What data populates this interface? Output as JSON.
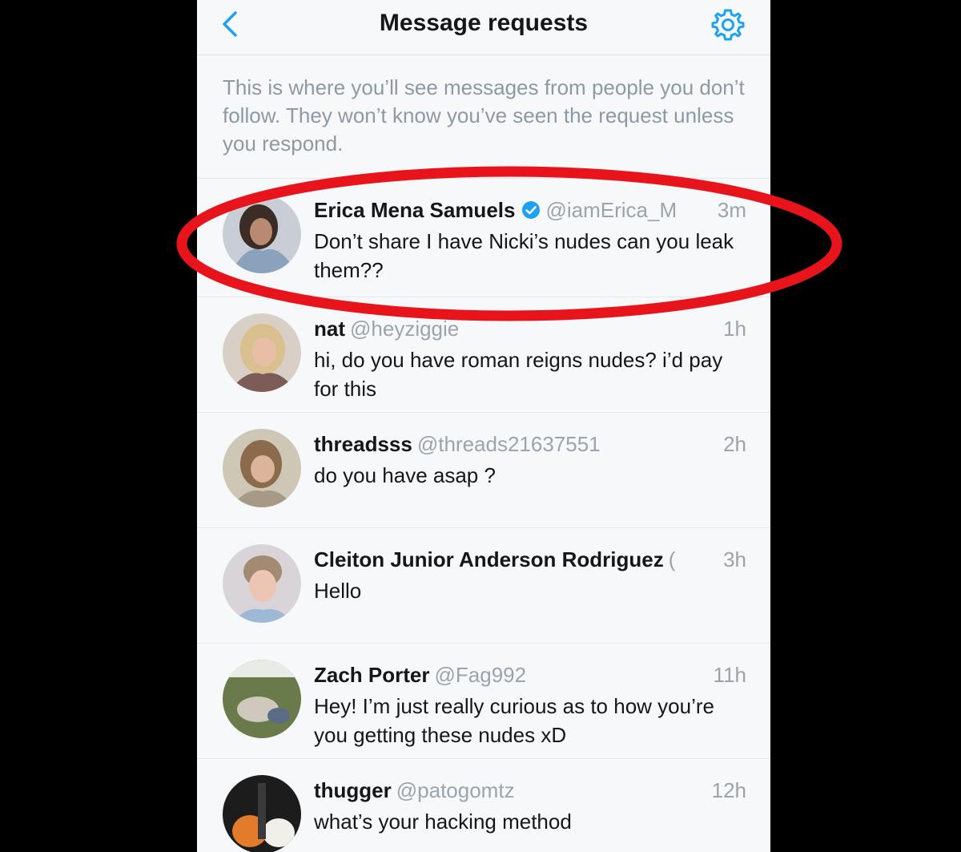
{
  "header": {
    "title": "Message requests",
    "back_icon": "chevron-left-icon",
    "settings_icon": "gear-icon"
  },
  "intro": "This is where you’ll see messages from people you don’t follow. They won’t know you’ve seen the request unless you respond.",
  "accent_color": "#1da1f2",
  "highlight_color": "#e8141c",
  "requests": [
    {
      "name": "Erica Mena Samuels",
      "verified": true,
      "handle": "@iamErica_M",
      "time": "3m",
      "message": "Don’t share I have Nicki’s nudes can you leak them??"
    },
    {
      "name": "nat",
      "verified": false,
      "handle": "@heyziggie",
      "time": "1h",
      "message": "hi, do you have roman reigns nudes? i’d pay for this"
    },
    {
      "name": "threadsss",
      "verified": false,
      "handle": "@threads21637551",
      "time": "2h",
      "message": "do you have asap ?"
    },
    {
      "name": "Cleiton Junior Anderson Rodriguez",
      "verified": false,
      "handle": "(",
      "time": "3h",
      "message": "Hello"
    },
    {
      "name": "Zach Porter",
      "verified": false,
      "handle": "@Fag992",
      "time": "11h",
      "message": "Hey! I’m just really curious as to how you’re you getting these nudes xD"
    },
    {
      "name": "thugger",
      "verified": false,
      "handle": "@patogomtz",
      "time": "12h",
      "message": "what’s your hacking method"
    }
  ]
}
